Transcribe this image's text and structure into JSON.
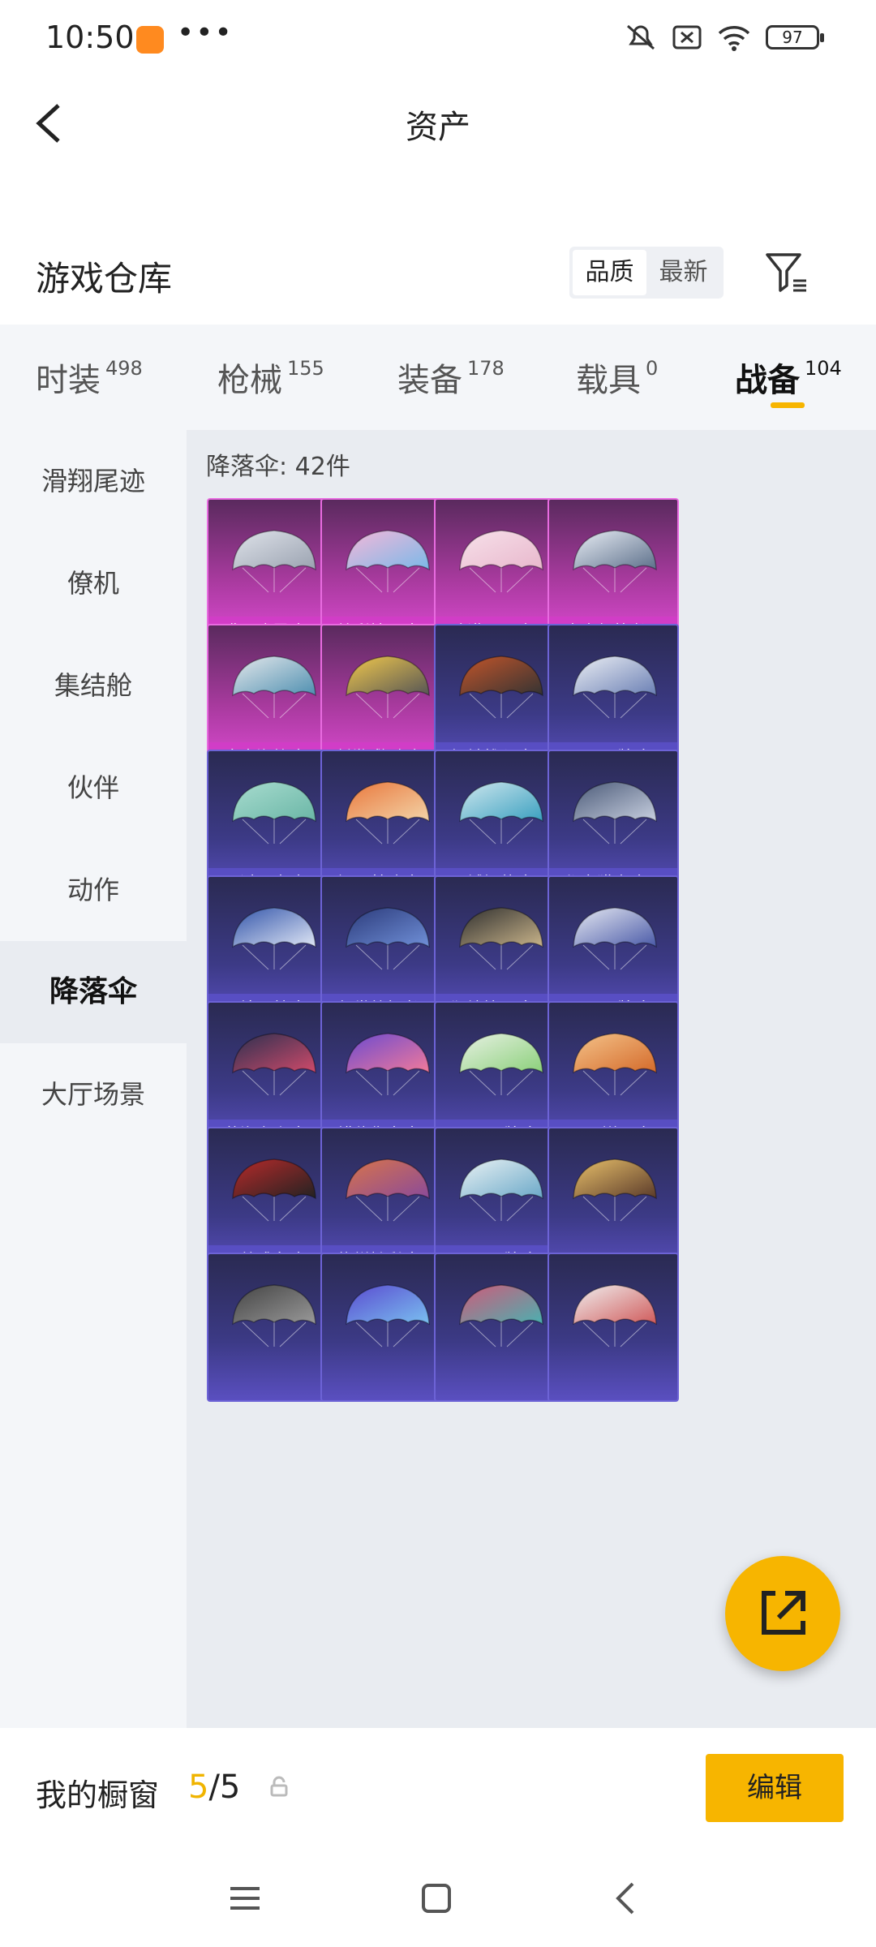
{
  "status_bar": {
    "time": "10:50",
    "battery": "97"
  },
  "header": {
    "title": "资产"
  },
  "warehouse": {
    "title": "游戏仓库",
    "sort_quality": "品质",
    "sort_newest": "最新"
  },
  "tabs": [
    {
      "label": "时装",
      "count": "498"
    },
    {
      "label": "枪械",
      "count": "155"
    },
    {
      "label": "装备",
      "count": "178"
    },
    {
      "label": "载具",
      "count": "0"
    },
    {
      "label": "战备",
      "count": "104"
    }
  ],
  "active_tab": "战备",
  "sidebar": {
    "items": [
      {
        "label": "滑翔尾迹"
      },
      {
        "label": "僚机"
      },
      {
        "label": "集结舱"
      },
      {
        "label": "伙伴"
      },
      {
        "label": "动作"
      },
      {
        "label": "降落伞"
      },
      {
        "label": "大厅场景"
      }
    ],
    "active": "降落伞"
  },
  "content": {
    "count_label": "降落伞: 42件",
    "items": [
      {
        "name": "鸢尾珑霧降…",
        "rarity": "legend"
      },
      {
        "name": "炫彩糖果降…",
        "rarity": "legend"
      },
      {
        "name": "冷漠罗丽降…",
        "rarity": "legend"
      },
      {
        "name": "未来领航者…",
        "rarity": "legend"
      },
      {
        "name": "金丰海韵降…",
        "rarity": "legend"
      },
      {
        "name": "创世·救赎降…",
        "rarity": "legend"
      },
      {
        "name": "钢铁雄心降…",
        "rarity": "epic"
      },
      {
        "name": "SS37王牌降…",
        "rarity": "epic"
      },
      {
        "name": "雨过天青降…",
        "rarity": "epic"
      },
      {
        "name": "福马献瑞降…",
        "rarity": "epic"
      },
      {
        "name": "异域银装降…",
        "rarity": "epic"
      },
      {
        "name": "都市猎人降…",
        "rarity": "epic"
      },
      {
        "name": "画境星梦降…",
        "rarity": "epic"
      },
      {
        "name": "幻世战舞者…",
        "rarity": "epic"
      },
      {
        "name": "狂鲨锋刃降…",
        "rarity": "epic"
      },
      {
        "name": "SS36王牌降…",
        "rarity": "epic"
      },
      {
        "name": "蓝海之火降…",
        "rarity": "epic"
      },
      {
        "name": "错位像素降…",
        "rarity": "epic"
      },
      {
        "name": "SS35王牌降…",
        "rarity": "epic"
      },
      {
        "name": "2023祥云降…",
        "rarity": "epic"
      },
      {
        "name": "百战成名降…",
        "rarity": "epic"
      },
      {
        "name": "绚烂橙彩降…",
        "rarity": "epic"
      },
      {
        "name": "SS34王牌降…",
        "rarity": "epic"
      },
      {
        "name": "",
        "rarity": "epic"
      },
      {
        "name": "",
        "rarity": "epic"
      },
      {
        "name": "",
        "rarity": "epic"
      },
      {
        "name": "",
        "rarity": "epic"
      },
      {
        "name": "",
        "rarity": "epic"
      }
    ]
  },
  "showcase": {
    "label": "我的橱窗",
    "current": "5",
    "total": "/5",
    "edit_label": "编辑"
  },
  "colors": {
    "accent": "#f7b500",
    "legend": "#e04bd6",
    "epic": "#5a4fc0"
  }
}
